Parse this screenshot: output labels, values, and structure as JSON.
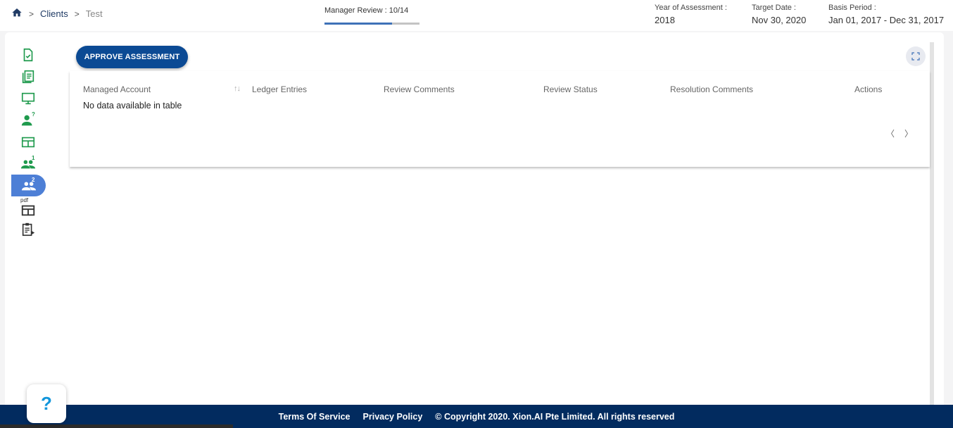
{
  "breadcrumb": {
    "home_icon": "home-icon",
    "items": [
      "Clients",
      "Test"
    ]
  },
  "progress": {
    "label": "Manager Review : 10/14",
    "fraction": 0.714
  },
  "meta": {
    "year_label": "Year of Assessment :",
    "year_value": "2018",
    "target_label": "Target Date :",
    "target_value": "Nov 30, 2020",
    "basis_label": "Basis Period :",
    "basis_value": "Jan 01, 2017 - Dec 31, 2017"
  },
  "sidebar": {
    "items": [
      {
        "icon": "document-check-icon",
        "active": false
      },
      {
        "icon": "document-list-icon",
        "active": false
      },
      {
        "icon": "monitor-icon",
        "active": false
      },
      {
        "icon": "person-question-icon",
        "sup": "?",
        "active": false
      },
      {
        "icon": "table-icon",
        "active": false
      },
      {
        "icon": "people-1-icon",
        "sup": "1",
        "active": false
      },
      {
        "icon": "people-2-icon",
        "sup": "2",
        "active": true
      },
      {
        "icon": "pdf-table-icon",
        "tag": "pdf",
        "active": false
      },
      {
        "icon": "clipboard-play-icon",
        "active": false
      }
    ]
  },
  "toolbar": {
    "approve_label": "APPROVE ASSESSMENT",
    "expand_icon": "fullscreen-icon"
  },
  "table": {
    "columns": [
      "Managed Account",
      "Ledger Entries",
      "Review Comments",
      "Review Status",
      "Resolution Comments",
      "Actions"
    ],
    "empty_message": "No data available in table",
    "pager_prev": "〈",
    "pager_next": "〉"
  },
  "footer": {
    "terms": "Terms Of Service",
    "privacy": "Privacy Policy",
    "copyright": "© Copyright 2020. Xion.AI Pte Limited. All rights reserved"
  },
  "help": {
    "label": "?"
  },
  "colors": {
    "brand": "#0b4a94",
    "footer": "#022b5f",
    "accent_green": "#1f9a4d",
    "active_nav": "#4d7fd6"
  }
}
